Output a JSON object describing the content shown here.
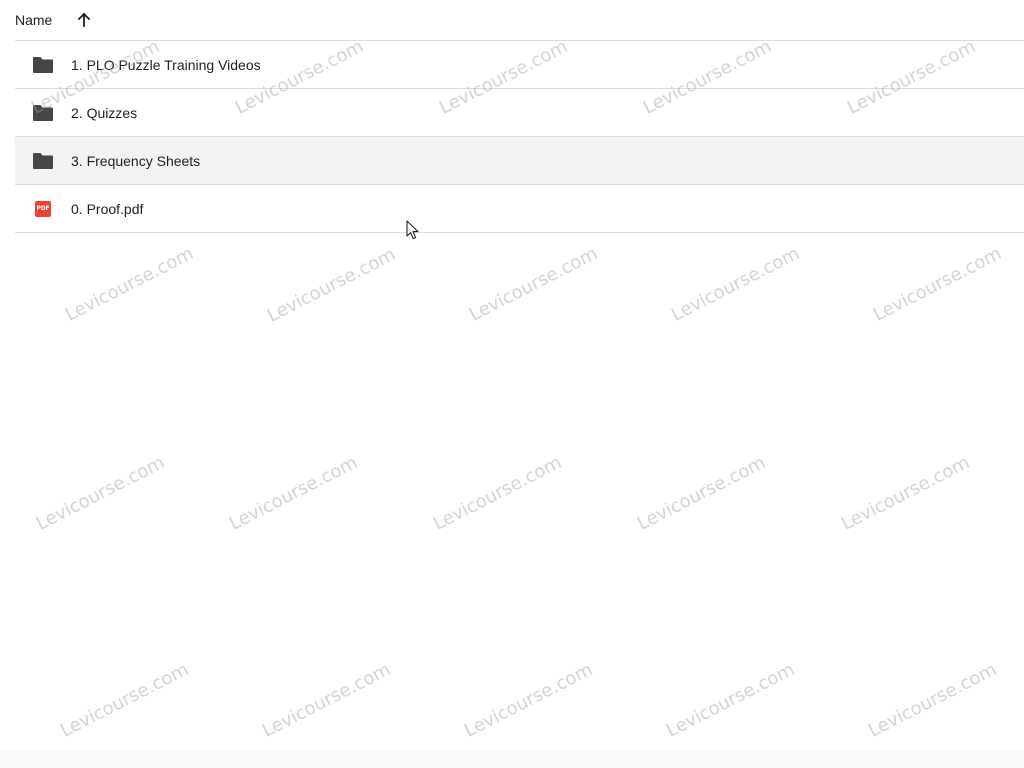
{
  "header": {
    "name_label": "Name",
    "sort_icon": "arrow-up-icon"
  },
  "files": [
    {
      "name": "1. PLO Puzzle Training Videos",
      "type": "folder",
      "icon": "folder-icon"
    },
    {
      "name": "2. Quizzes",
      "type": "folder",
      "icon": "folder-icon"
    },
    {
      "name": "3. Frequency Sheets",
      "type": "folder",
      "icon": "folder-icon",
      "selected": true
    },
    {
      "name": "0. Proof.pdf",
      "type": "pdf",
      "icon": "pdf-icon",
      "badge_text": "PDF"
    }
  ],
  "watermark": {
    "text": "Levicourse.com"
  },
  "colors": {
    "folder": "#444746",
    "pdf": "#ea4335",
    "divider": "#dadce0",
    "selected_row": "#f1f3f4"
  }
}
